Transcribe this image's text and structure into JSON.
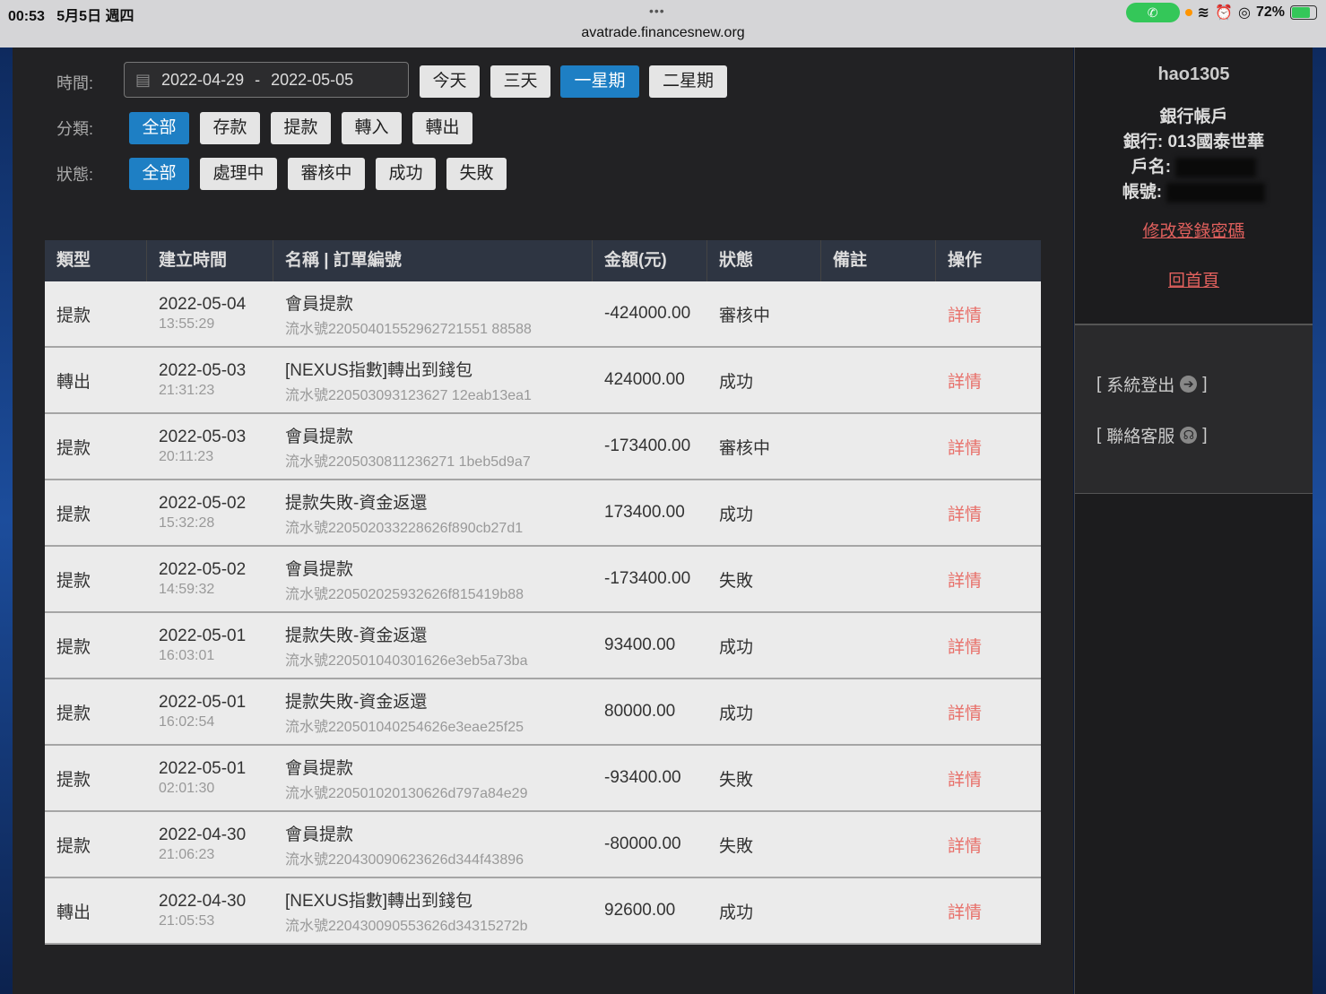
{
  "statusbar": {
    "time": "00:53",
    "date": "5月5日 週四",
    "url": "avatrade.financesnew.org",
    "battery": "72%",
    "dots": "•••"
  },
  "filters": {
    "time_label": "時間:",
    "date_from": "2022-04-29",
    "date_sep": "-",
    "date_to": "2022-05-05",
    "time_buttons": [
      "今天",
      "三天",
      "一星期",
      "二星期"
    ],
    "category_label": "分類:",
    "category_buttons": [
      "全部",
      "存款",
      "提款",
      "轉入",
      "轉出"
    ],
    "status_label": "狀態:",
    "status_buttons": [
      "全部",
      "處理中",
      "審核中",
      "成功",
      "失敗"
    ]
  },
  "table": {
    "headers": [
      "類型",
      "建立時間",
      "名稱 | 訂單編號",
      "金額(元)",
      "狀態",
      "備註",
      "操作"
    ],
    "rows": [
      {
        "type": "提款",
        "date": "2022-05-04",
        "time": "13:55:29",
        "name": "會員提款",
        "serial": "流水號22050401552962721551 88588",
        "amount": "-424000.00",
        "status": "審核中",
        "action": "詳情"
      },
      {
        "type": "轉出",
        "date": "2022-05-03",
        "time": "21:31:23",
        "name": "[NEXUS指數]轉出到錢包",
        "serial": "流水號220503093123627 12eab13ea1",
        "amount": "424000.00",
        "status": "成功",
        "action": "詳情"
      },
      {
        "type": "提款",
        "date": "2022-05-03",
        "time": "20:11:23",
        "name": "會員提款",
        "serial": "流水號2205030811236271 1beb5d9a7",
        "amount": "-173400.00",
        "status": "審核中",
        "action": "詳情"
      },
      {
        "type": "提款",
        "date": "2022-05-02",
        "time": "15:32:28",
        "name": "提款失敗-資金返還",
        "serial": "流水號220502033228626f890cb27d1",
        "amount": "173400.00",
        "status": "成功",
        "action": "詳情"
      },
      {
        "type": "提款",
        "date": "2022-05-02",
        "time": "14:59:32",
        "name": "會員提款",
        "serial": "流水號220502025932626f815419b88",
        "amount": "-173400.00",
        "status": "失敗",
        "action": "詳情"
      },
      {
        "type": "提款",
        "date": "2022-05-01",
        "time": "16:03:01",
        "name": "提款失敗-資金返還",
        "serial": "流水號220501040301626e3eb5a73ba",
        "amount": "93400.00",
        "status": "成功",
        "action": "詳情"
      },
      {
        "type": "提款",
        "date": "2022-05-01",
        "time": "16:02:54",
        "name": "提款失敗-資金返還",
        "serial": "流水號220501040254626e3eae25f25",
        "amount": "80000.00",
        "status": "成功",
        "action": "詳情"
      },
      {
        "type": "提款",
        "date": "2022-05-01",
        "time": "02:01:30",
        "name": "會員提款",
        "serial": "流水號220501020130626d797a84e29",
        "amount": "-93400.00",
        "status": "失敗",
        "action": "詳情"
      },
      {
        "type": "提款",
        "date": "2022-04-30",
        "time": "21:06:23",
        "name": "會員提款",
        "serial": "流水號220430090623626d344f43896",
        "amount": "-80000.00",
        "status": "失敗",
        "action": "詳情"
      },
      {
        "type": "轉出",
        "date": "2022-04-30",
        "time": "21:05:53",
        "name": "[NEXUS指數]轉出到錢包",
        "serial": "流水號220430090553626d34315272b",
        "amount": "92600.00",
        "status": "成功",
        "action": "詳情"
      }
    ]
  },
  "sidebar": {
    "username": "hao1305",
    "bank_title": "銀行帳戶",
    "bank": "銀行: 013國泰世華",
    "holder_label": "戶名:",
    "account_label": "帳號:",
    "change_password": "修改登錄密碼",
    "home": "回首頁",
    "logout": "系統登出",
    "support": "聯絡客服",
    "bracket_open": "[",
    "bracket_close": "]"
  }
}
